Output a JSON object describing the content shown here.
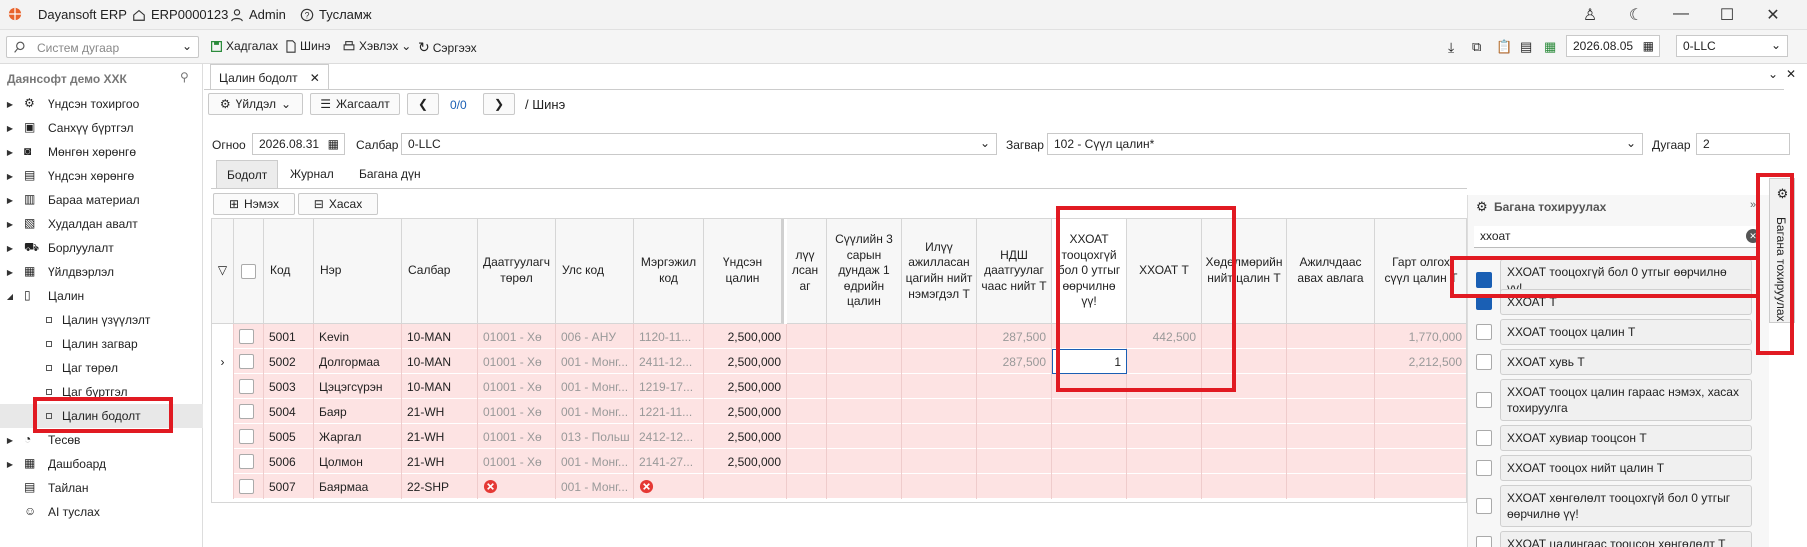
{
  "titlebar": {
    "app_name": "Dayansoft ERP",
    "doc_no": "ERP0000123",
    "user": "Admin",
    "help": "Тусламж"
  },
  "toolbar": {
    "search_placeholder": "Систем дугаар",
    "save": "Хадгалах",
    "new": "Шинэ",
    "print": "Хэвлэх",
    "refresh": "Сэргээх",
    "date": "2026.08.05",
    "company": "0-LLC"
  },
  "sidebar": {
    "title": "Даянсофт демо ХХК",
    "items": [
      "Үндсэн тохиргоо",
      "Санхүү бүртгэл",
      "Мөнгөн хөрөнгө",
      "Үндсэн хөрөнгө",
      "Бараа материал",
      "Худалдан авалт",
      "Борлуулалт",
      "Үйлдвэрлэл",
      "Цалин"
    ],
    "sub_items": [
      "Цалин үзүүлэлт",
      "Цалин загвар",
      "Цаг төрөл",
      "Цаг бүртгэл",
      "Цалин бодолт"
    ],
    "bottom_items": [
      "Тесөв",
      "Дашбоард",
      "Тайлан",
      "AI туслах"
    ]
  },
  "tab": {
    "label": "Цалин бодолт"
  },
  "actions": {
    "process": "Үйлдэл",
    "list": "Жагсаалт",
    "counter": "0/0",
    "breadcrumb": "/ Шинэ"
  },
  "form": {
    "date_label": "Огноо",
    "date_value": "2026.08.31",
    "branch_label": "Салбар",
    "branch_value": "0-LLC",
    "template_label": "Загвар",
    "template_value": "102 - Сүүл цалин*",
    "number_label": "Дугаар",
    "number_value": "2"
  },
  "subtabs": [
    "Бодолт",
    "Журнал",
    "Багана дүн"
  ],
  "grid_buttons": {
    "add": "Нэмэх",
    "remove": "Хасах"
  },
  "columns": {
    "code": "Код",
    "name": "Нэр",
    "branch": "Салбар",
    "insured_type": "Даатгуулагч төрөл",
    "country": "Улс код",
    "occupation": "Мэргэжил код",
    "base_salary": "Үндсэн цалин",
    "c_partial": "лүү лсан аг",
    "avg3": "Сүүлийн 3 сарын дундаж 1 өдрийн цалин",
    "overtime": "Илүү ажилласан цагийн нийт нэмэгдэл Т",
    "ndsh": "НДШ даатгуулаг чаас нийт Т",
    "pit_zero": "ХХОАТ тооцохгүй бол 0 утгыг өөрчилнө үү!",
    "pit": "ХХОАТ Т",
    "handed": "Хөдөлмөрийн нийт цалин Т",
    "advance": "Ажилчдаас авах авлага",
    "net": "Гарт олгох сүүл цалин Т"
  },
  "rows": [
    {
      "code": "5001",
      "name": "Kevin",
      "branch": "10-MAN",
      "insured": "01001 - Хө",
      "country": "006 - АНУ",
      "occupation": "1120-11...",
      "salary": "2,500,000",
      "ndsh": "287,500",
      "pit_zero": "",
      "pit": "442,500",
      "net": "1,770,000"
    },
    {
      "code": "5002",
      "name": "Долгормаа",
      "branch": "10-MAN",
      "insured": "01001 - Хө",
      "country": "001 - Монг...",
      "occupation": "2411-12...",
      "salary": "2,500,000",
      "ndsh": "287,500",
      "pit_zero": "1",
      "pit": "",
      "net": "2,212,500"
    },
    {
      "code": "5003",
      "name": "Цэцэгсүрэн",
      "branch": "10-MAN",
      "insured": "01001 - Хө",
      "country": "001 - Монг...",
      "occupation": "1219-17...",
      "salary": "2,500,000",
      "ndsh": "",
      "pit_zero": "",
      "pit": "",
      "net": ""
    },
    {
      "code": "5004",
      "name": "Баяр",
      "branch": "21-WH",
      "insured": "01001 - Хө",
      "country": "001 - Монг...",
      "occupation": "1221-11...",
      "salary": "2,500,000",
      "ndsh": "",
      "pit_zero": "",
      "pit": "",
      "net": ""
    },
    {
      "code": "5005",
      "name": "Жаргал",
      "branch": "21-WH",
      "insured": "01001 - Хө",
      "country": "013 - Польш",
      "occupation": "2412-12...",
      "salary": "2,500,000",
      "ndsh": "",
      "pit_zero": "",
      "pit": "",
      "net": ""
    },
    {
      "code": "5006",
      "name": "Цолмон",
      "branch": "21-WH",
      "insured": "01001 - Хө",
      "country": "001 - Монг...",
      "occupation": "2141-27...",
      "salary": "2,500,000",
      "ndsh": "",
      "pit_zero": "",
      "pit": "",
      "net": ""
    },
    {
      "code": "5007",
      "name": "Баярмаа",
      "branch": "22-SHP",
      "insured": "",
      "country": "001 - Монг...",
      "occupation": "",
      "salary": "",
      "ndsh": "",
      "pit_zero": "",
      "pit": "",
      "net": ""
    }
  ],
  "panel": {
    "title": "Багана тохируулах",
    "search_value": "ххоат",
    "items": [
      {
        "label": "ХХОАТ тооцохгүй бол 0 утгыг өөрчилнө үү!",
        "checked": true
      },
      {
        "label": "ХХОАТ Т",
        "checked": true
      },
      {
        "label": "ХХОАТ тооцох цалин Т",
        "checked": false
      },
      {
        "label": "ХХОАТ хувь Т",
        "checked": false
      },
      {
        "label": "ХХОАТ тооцох цалин гараас нэмэх, хасах тохируулга",
        "checked": false
      },
      {
        "label": "ХХОАТ хувиар тооцсон Т",
        "checked": false
      },
      {
        "label": "ХХОАТ тооцох нийт цалин Т",
        "checked": false
      },
      {
        "label": "ХХОАТ хөнгөлөлт тооцохгүй бол 0 утгыг өөрчилнө үү!",
        "checked": false
      },
      {
        "label": "ХХОАТ цалингаас тооцсон хөнгөлөлт Т",
        "checked": false
      }
    ],
    "vertical_tab": "Багана тохируулах"
  },
  "colors": {
    "accent": "#1a5fb4",
    "highlight": "#e11a22",
    "row_bg": "#fde3e3"
  }
}
